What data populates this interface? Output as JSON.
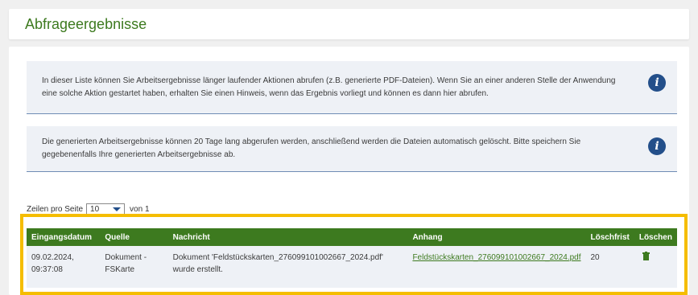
{
  "page": {
    "title": "Abfrageergebnisse"
  },
  "info": [
    {
      "text": "In dieser Liste können Sie Arbeitsergebnisse länger laufender Aktionen abrufen (z.B. generierte PDF-Dateien). Wenn Sie an einer anderen Stelle der Anwendung eine solche Aktion gestartet haben, erhalten Sie einen Hinweis, wenn das Ergebnis vorliegt und können es dann hier abrufen.",
      "icon": "info-icon"
    },
    {
      "text": "Die generierten Arbeitsergebnisse können 20 Tage lang abgerufen werden, anschließend werden die Dateien automatisch gelöscht. Bitte speichern Sie gegebenenfalls Ihre generierten Arbeitsergebnisse ab.",
      "icon": "info-icon"
    }
  ],
  "pager": {
    "label": "Zeilen pro Seite",
    "value": "10",
    "of_text": "von 1"
  },
  "table": {
    "headers": [
      "Eingangsdatum",
      "Quelle",
      "Nachricht",
      "Anhang",
      "Löschfrist",
      "Löschen"
    ],
    "rows": [
      {
        "date": "09.02.2024,",
        "time": "09:37:08",
        "source_line1": "Dokument -",
        "source_line2": "FSKarte",
        "message": "Dokument 'Feldstückskarten_276099101002667_2024.pdf' wurde erstellt.",
        "attachment": "Feldstückskarten_276099101002667_2024.pdf",
        "deadline": "20",
        "delete_icon": "trash-icon"
      }
    ]
  },
  "colors": {
    "accent_green": "#3d7a1f",
    "info_blue": "#234f8a",
    "highlight": "#f5bd00"
  }
}
